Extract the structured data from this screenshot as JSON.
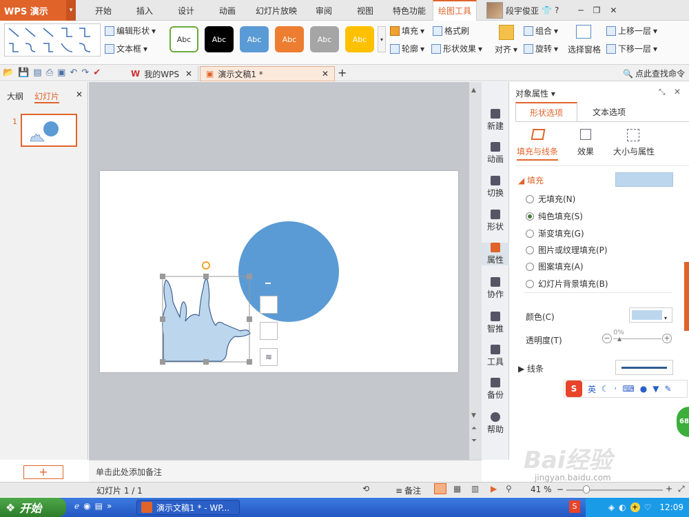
{
  "app": {
    "logo": "WPS 演示",
    "logo_dd": "▾",
    "user": "段宇俊亚",
    "help": "?"
  },
  "tabs": [
    "开始",
    "插入",
    "设计",
    "动画",
    "幻灯片放映",
    "审阅",
    "视图",
    "特色功能",
    "绘图工具"
  ],
  "toolbar": {
    "edit_shape": "编辑形状",
    "text_box": "文本框",
    "style_label": "Abc",
    "fill": "填充",
    "format_brush": "格式刷",
    "outline": "轮廓",
    "shape_effect": "形状效果",
    "align": "对齐",
    "group": "组合",
    "rotate": "旋转",
    "selection_pane": "选择窗格",
    "bring_forward": "上移一层",
    "send_backward": "下移一层",
    "style_colors": [
      "#ffffff",
      "#000000",
      "#5b9bd5",
      "#ed7d31",
      "#a5a5a5",
      "#ffc000"
    ]
  },
  "doc_tabs": {
    "mywps": "我的WPS",
    "doc": "演示文稿1 *",
    "search": "点此查找命令"
  },
  "left_panel": {
    "outline_tab": "大纲",
    "slides_tab": "幻灯片",
    "slide_num": "1",
    "add": "+"
  },
  "sidebar": [
    "新建",
    "动画",
    "切换",
    "形状",
    "属性",
    "协作",
    "智推",
    "工具",
    "备份",
    "帮助"
  ],
  "props": {
    "title": "对象属性 ▾",
    "tab_shape": "形状选项",
    "tab_text": "文本选项",
    "sub_fill_line": "填充与线条",
    "sub_effect": "效果",
    "sub_size": "大小与属性",
    "fill_header": "填充",
    "fill_options": [
      "无填充(N)",
      "纯色填充(S)",
      "渐变填充(G)",
      "图片或纹理填充(P)",
      "图案填充(A)",
      "幻灯片背景填充(B)"
    ],
    "color_label": "颜色(C)",
    "transparency_label": "透明度(T)",
    "transparency_value": "0%",
    "line_header": "线条",
    "fill_color": "#bcd6ee"
  },
  "ime": {
    "s": "S",
    "lang": "英"
  },
  "notes_placeholder": "单击此处添加备注",
  "status": {
    "slide_info": "幻灯片 1 / 1",
    "notes": "备注",
    "zoom": "41 %"
  },
  "taskbar": {
    "start": "开始",
    "app": "演示文稿1 * - WP...",
    "time": "12:09"
  },
  "watermark": {
    "brand": "Bai经验",
    "url": "jingyan.baidu.com"
  },
  "badge": "68",
  "slide_shapes": {
    "circle_color": "#5b9bd5",
    "splash_color": "#bcd6ee"
  }
}
